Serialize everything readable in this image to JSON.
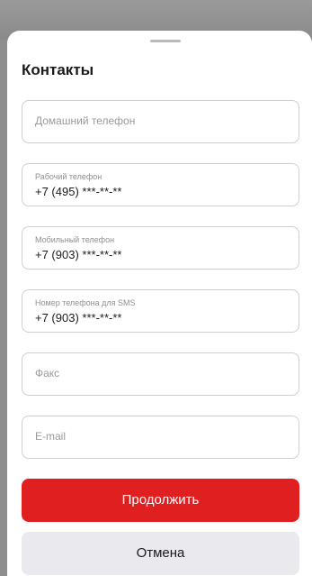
{
  "sheet": {
    "title": "Контакты"
  },
  "fields": [
    {
      "placeholder": "Домашний телефон",
      "label": "",
      "value": ""
    },
    {
      "placeholder": "",
      "label": "Рабочий телефон",
      "value": "+7 (495) ***-**-**"
    },
    {
      "placeholder": "",
      "label": "Мобильный телефон",
      "value": "+7 (903) ***-**-**"
    },
    {
      "placeholder": "",
      "label": "Номер телефона для SMS",
      "value": "+7 (903) ***-**-**"
    },
    {
      "placeholder": "Факс",
      "label": "",
      "value": ""
    },
    {
      "placeholder": "E-mail",
      "label": "",
      "value": ""
    }
  ],
  "buttons": {
    "continue_label": "Продолжить",
    "cancel_label": "Отмена"
  },
  "colors": {
    "primary": "#e02020",
    "secondary": "#e9e9ee"
  }
}
